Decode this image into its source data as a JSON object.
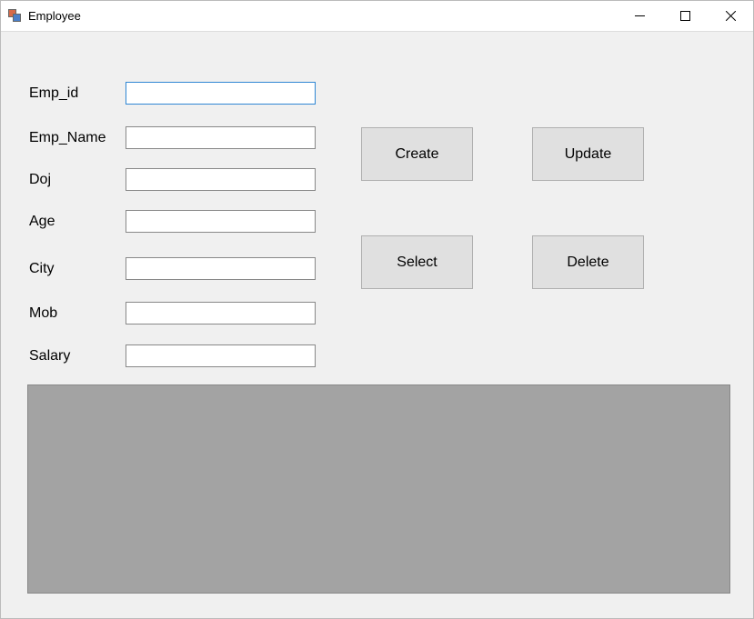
{
  "window": {
    "title": "Employee"
  },
  "labels": {
    "emp_id": "Emp_id",
    "emp_name": "Emp_Name",
    "doj": "Doj",
    "age": "Age",
    "city": "City",
    "mob": "Mob",
    "salary": "Salary"
  },
  "fields": {
    "emp_id": "",
    "emp_name": "",
    "doj": "",
    "age": "",
    "city": "",
    "mob": "",
    "salary": ""
  },
  "buttons": {
    "create": "Create",
    "update": "Update",
    "select": "Select",
    "delete": "Delete"
  }
}
